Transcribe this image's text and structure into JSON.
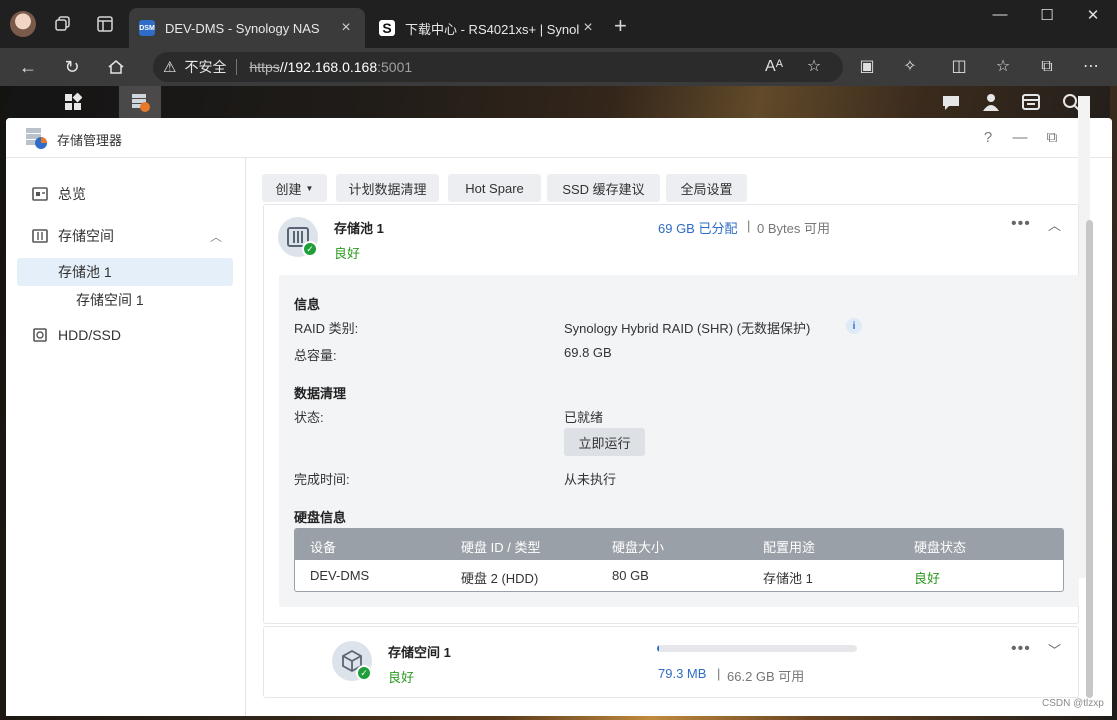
{
  "browser": {
    "tabs": [
      {
        "title": "DEV-DMS - Synology NAS",
        "favicon": "DSM",
        "close": "×"
      },
      {
        "title": "下载中心 - RS4021xs+ | Synology",
        "favicon": "S",
        "close": "×"
      }
    ],
    "new_tab": "+",
    "address": {
      "security_label": "不安全",
      "scheme": "https",
      "host": "//192.168.0.168",
      "port": ":5001"
    }
  },
  "window": {
    "title": "存储管理器"
  },
  "sidebar": {
    "items": [
      {
        "label": "总览"
      },
      {
        "label": "存储空间"
      },
      {
        "label": "存储池 1"
      },
      {
        "label": "存储空间 1"
      },
      {
        "label": "HDD/SSD"
      }
    ]
  },
  "toolbar": {
    "create": "创建",
    "scrub_plan": "计划数据清理",
    "hot_spare": "Hot Spare",
    "ssd_cache": "SSD 缓存建议",
    "global_settings": "全局设置"
  },
  "pool": {
    "name": "存储池 1",
    "status": "良好",
    "allocated": "69 GB 已分配",
    "divider": "|",
    "available": "0 Bytes 可用",
    "more": "•••",
    "info_heading": "信息",
    "raid_label": "RAID 类别:",
    "raid_value": "Synology Hybrid RAID (SHR) (无数据保护)",
    "capacity_label": "总容量:",
    "capacity_value": "69.8 GB",
    "scrub_heading": "数据清理",
    "scrub_status_label": "状态:",
    "scrub_status_value": "已就绪",
    "run_now": "立即运行",
    "finish_label": "完成时间:",
    "finish_value": "从未执行",
    "disk_heading": "硬盘信息",
    "disk_columns": [
      "设备",
      "硬盘 ID / 类型",
      "硬盘大小",
      "配置用途",
      "硬盘状态"
    ],
    "disk_rows": [
      [
        "DEV-DMS",
        "硬盘 2 (HDD)",
        "80 GB",
        "存储池 1",
        "良好"
      ]
    ]
  },
  "volume": {
    "name": "存储空间 1",
    "status": "良好",
    "used": "79.3 MB",
    "divider": "|",
    "available": "66.2 GB 可用",
    "usage_fraction": 0.012,
    "more": "•••"
  },
  "watermark": "CSDN @tlzxp",
  "colors": {
    "good": "#2b9a1f",
    "accent": "#2e6cc7",
    "table_header": "#9aa0a7"
  }
}
